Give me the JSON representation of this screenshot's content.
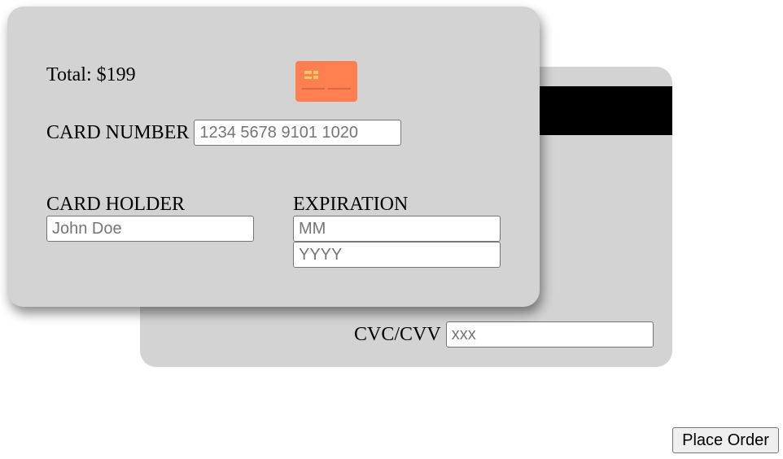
{
  "colors": {
    "card_background": "#d3d3d3",
    "magnetic_stripe": "#000000",
    "chip_accent": "#ff7f50",
    "chip_lines": "#f5c56b"
  },
  "card_front": {
    "total": "Total: $199",
    "chip_icon": "credit-card-icon",
    "card_number": {
      "label": "CARD NUMBER",
      "placeholder": "1234 5678 9101 1020",
      "value": ""
    },
    "card_holder": {
      "label": "CARD HOLDER",
      "placeholder": "John Doe",
      "value": ""
    },
    "expiration": {
      "label": "EXPIRATION",
      "month_placeholder": "MM",
      "year_placeholder": "YYYY",
      "month_value": "",
      "year_value": ""
    }
  },
  "card_back": {
    "cvc": {
      "label": "CVC/CVV",
      "placeholder": "xxx",
      "value": ""
    }
  },
  "actions": {
    "place_order_label": "Place Order"
  }
}
